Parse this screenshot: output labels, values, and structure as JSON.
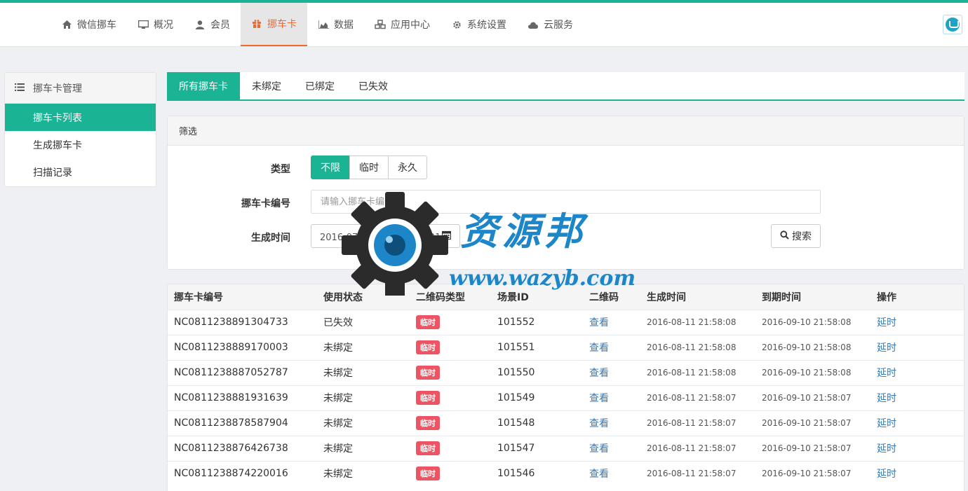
{
  "nav": {
    "items": [
      {
        "label": "微信挪车",
        "icon": "home-icon"
      },
      {
        "label": "概况",
        "icon": "monitor-icon"
      },
      {
        "label": "会员",
        "icon": "user-icon"
      },
      {
        "label": "挪车卡",
        "icon": "gift-icon",
        "active": true
      },
      {
        "label": "数据",
        "icon": "area-chart-icon"
      },
      {
        "label": "应用中心",
        "icon": "cubes-icon"
      },
      {
        "label": "系统设置",
        "icon": "gear-icon"
      },
      {
        "label": "云服务",
        "icon": "cloud-icon"
      }
    ]
  },
  "sidebar": {
    "title": "挪车卡管理",
    "items": [
      {
        "label": "挪车卡列表",
        "active": true
      },
      {
        "label": "生成挪车卡"
      },
      {
        "label": "扫描记录"
      }
    ]
  },
  "tabs": [
    {
      "label": "所有挪车卡",
      "active": true
    },
    {
      "label": "未绑定"
    },
    {
      "label": "已绑定"
    },
    {
      "label": "已失效"
    }
  ],
  "filter": {
    "title": "筛选",
    "type_label": "类型",
    "type_options": [
      "不限",
      "临时",
      "永久"
    ],
    "type_selected": "不限",
    "number_label": "挪车卡编号",
    "number_placeholder": "请输入挪车卡编号",
    "time_label": "生成时间",
    "time_value": "2016-07-10 至 2016-08-21",
    "search_label": "搜索"
  },
  "table": {
    "headers": [
      "挪车卡编号",
      "使用状态",
      "二维码类型",
      "场景ID",
      "二维码",
      "生成时间",
      "到期时间",
      "操作"
    ],
    "rows": [
      {
        "no": "NC0811238891304733",
        "status": "已失效",
        "type": "临时",
        "scene": "101552",
        "qr": "查看",
        "created": "2016-08-11 21:58:08",
        "expires": "2016-09-10 21:58:08",
        "op": "延时"
      },
      {
        "no": "NC0811238889170003",
        "status": "未绑定",
        "type": "临时",
        "scene": "101551",
        "qr": "查看",
        "created": "2016-08-11 21:58:08",
        "expires": "2016-09-10 21:58:08",
        "op": "延时"
      },
      {
        "no": "NC0811238887052787",
        "status": "未绑定",
        "type": "临时",
        "scene": "101550",
        "qr": "查看",
        "created": "2016-08-11 21:58:08",
        "expires": "2016-09-10 21:58:08",
        "op": "延时"
      },
      {
        "no": "NC0811238881931639",
        "status": "未绑定",
        "type": "临时",
        "scene": "101549",
        "qr": "查看",
        "created": "2016-08-11 21:58:07",
        "expires": "2016-09-10 21:58:07",
        "op": "延时"
      },
      {
        "no": "NC0811238878587904",
        "status": "未绑定",
        "type": "临时",
        "scene": "101548",
        "qr": "查看",
        "created": "2016-08-11 21:58:07",
        "expires": "2016-09-10 21:58:07",
        "op": "延时"
      },
      {
        "no": "NC0811238876426738",
        "status": "未绑定",
        "type": "临时",
        "scene": "101547",
        "qr": "查看",
        "created": "2016-08-11 21:58:07",
        "expires": "2016-09-10 21:58:07",
        "op": "延时"
      },
      {
        "no": "NC0811238874220016",
        "status": "未绑定",
        "type": "临时",
        "scene": "101546",
        "qr": "查看",
        "created": "2016-08-11 21:58:07",
        "expires": "2016-09-10 21:58:07",
        "op": "延时"
      }
    ]
  },
  "watermark": {
    "title": "资源邦",
    "url": "www.wazyb.com"
  },
  "colors": {
    "accent": "#1ab394",
    "nav_active": "#f0692d",
    "badge": "#ed5565",
    "link": "#337ab7"
  }
}
